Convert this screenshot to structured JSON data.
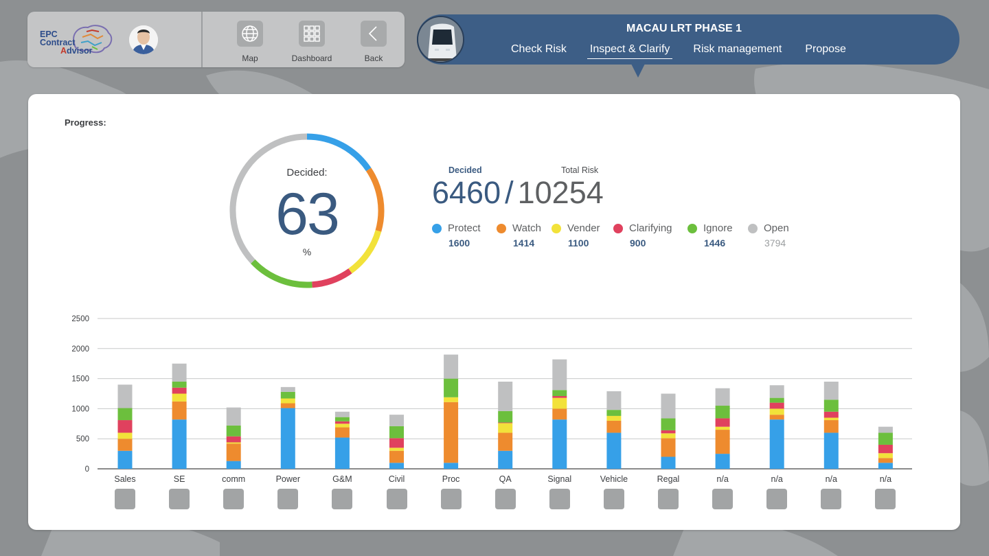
{
  "app": {
    "logo_lines": [
      "EPC",
      "Contract",
      "Advisor"
    ],
    "logo_red_letter": "A"
  },
  "nav": {
    "items": [
      {
        "label": "Map",
        "icon": "globe-icon"
      },
      {
        "label": "Dashboard",
        "icon": "grid-icon"
      },
      {
        "label": "Back",
        "icon": "chevron-left-icon"
      }
    ]
  },
  "project": {
    "title": "MACAU LRT PHASE 1",
    "tabs": [
      "Check Risk",
      "Inspect & Clarify",
      "Risk management",
      "Propose"
    ],
    "active_tab": "Inspect & Clarify"
  },
  "progress": {
    "label": "Progress:",
    "donut_label": "Decided:",
    "donut_value": "63",
    "donut_unit": "%",
    "decided_label": "Decided",
    "total_label": "Total Risk",
    "decided": "6460",
    "separator": "/",
    "total": "10254"
  },
  "legend": [
    {
      "name": "Protect",
      "value": "1600",
      "color": "#36a0e8"
    },
    {
      "name": "Watch",
      "value": "1414",
      "color": "#ee8b2e"
    },
    {
      "name": "Vender",
      "value": "1100",
      "color": "#f2e23a"
    },
    {
      "name": "Clarifying",
      "value": "900",
      "color": "#e0415e"
    },
    {
      "name": "Ignore",
      "value": "1446",
      "color": "#6cbf3d"
    },
    {
      "name": "Open",
      "value": "3794",
      "color": "#bfc0c1"
    }
  ],
  "chart_data": {
    "type": "bar",
    "stacked": true,
    "categories": [
      "Sales",
      "SE",
      "comm",
      "Power",
      "G&M",
      "Civil",
      "Proc",
      "QA",
      "Signal",
      "Vehicle",
      "Regal",
      "n/a",
      "n/a",
      "n/a",
      "n/a"
    ],
    "yticks": [
      "0",
      "500",
      "1000",
      "1500",
      "2000",
      "2500"
    ],
    "ylim": [
      0,
      2500
    ],
    "grid": true,
    "series": [
      {
        "name": "Protect",
        "color": "#36a0e8",
        "values": [
          300,
          820,
          130,
          1010,
          520,
          100,
          100,
          300,
          820,
          600,
          200,
          250,
          820,
          600,
          100
        ]
      },
      {
        "name": "Watch",
        "color": "#ee8b2e",
        "values": [
          200,
          300,
          290,
          80,
          170,
          200,
          1010,
          300,
          180,
          200,
          310,
          400,
          80,
          210,
          80
        ]
      },
      {
        "name": "Vender",
        "color": "#f2e23a",
        "values": [
          100,
          130,
          20,
          80,
          60,
          50,
          80,
          160,
          180,
          80,
          80,
          50,
          100,
          40,
          80
        ]
      },
      {
        "name": "Clarifying",
        "color": "#e0415e",
        "values": [
          210,
          100,
          100,
          0,
          40,
          160,
          0,
          10,
          30,
          0,
          50,
          140,
          100,
          100,
          140
        ]
      },
      {
        "name": "Ignore",
        "color": "#6cbf3d",
        "values": [
          200,
          100,
          180,
          110,
          70,
          200,
          310,
          190,
          100,
          100,
          200,
          210,
          80,
          200,
          200
        ]
      },
      {
        "name": "Open",
        "color": "#bfc0c1",
        "values": [
          390,
          300,
          300,
          80,
          90,
          190,
          400,
          490,
          510,
          310,
          410,
          290,
          210,
          300,
          100
        ]
      }
    ],
    "donut_segments_pct": [
      {
        "name": "Protect",
        "value": 15.6
      },
      {
        "name": "Watch",
        "value": 13.8
      },
      {
        "name": "Vender",
        "value": 10.7
      },
      {
        "name": "Clarifying",
        "value": 8.8
      },
      {
        "name": "Ignore",
        "value": 14.1
      },
      {
        "name": "Open",
        "value": 37.0
      }
    ]
  }
}
